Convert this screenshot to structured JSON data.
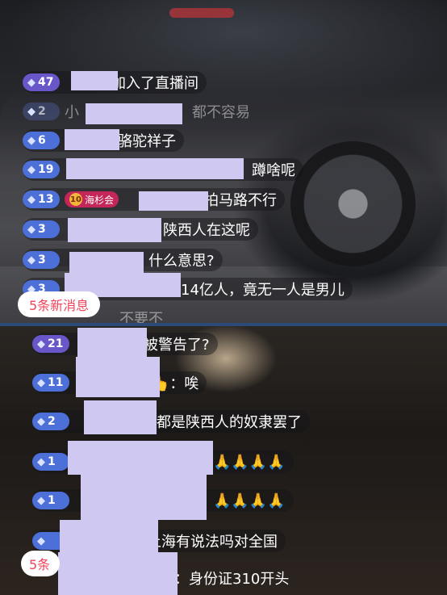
{
  "top": {
    "rows": [
      {
        "level": "47",
        "level_style": "purple",
        "message": "加入了直播间"
      },
      {
        "level": "2",
        "level_style": "dim",
        "message": "都不容易",
        "prefix": "小"
      },
      {
        "level": "6",
        "level_style": "blue",
        "message": "骆驼祥子"
      },
      {
        "level": "19",
        "level_style": "blue",
        "message": "蹲啥呢"
      },
      {
        "level": "13",
        "level_style": "blue",
        "badge_num": "10",
        "badge_label": "海杉会",
        "message": "拍马路不行"
      },
      {
        "level": "3",
        "level_style": "blue",
        "message": "陕西人在这呢"
      },
      {
        "level": "3",
        "level_style": "blue",
        "message": "什么意思?"
      },
      {
        "level": "3",
        "level_style": "blue",
        "message": "14亿人，竟无一人是男儿"
      },
      {
        "message": "不要不"
      }
    ],
    "new_messages_label": "5条新消息"
  },
  "bottom": {
    "rows": [
      {
        "level": "21",
        "level_style": "purple",
        "message": "被警告了?"
      },
      {
        "level": "11",
        "level_style": "blue",
        "message": "👆：唉"
      },
      {
        "level": "2",
        "level_style": "blue",
        "message": "都是陕西人的奴隶罢了"
      },
      {
        "level": "1",
        "level_style": "blue",
        "message": "🙏🙏🙏🙏"
      },
      {
        "level": "1",
        "level_style": "blue",
        "message": "🙏🙏🙏🙏"
      },
      {
        "level": "",
        "level_style": "blue",
        "message": "上海有说法吗对全国"
      },
      {
        "message": "：身份证310开头"
      }
    ],
    "new_messages_label": "5条"
  }
}
